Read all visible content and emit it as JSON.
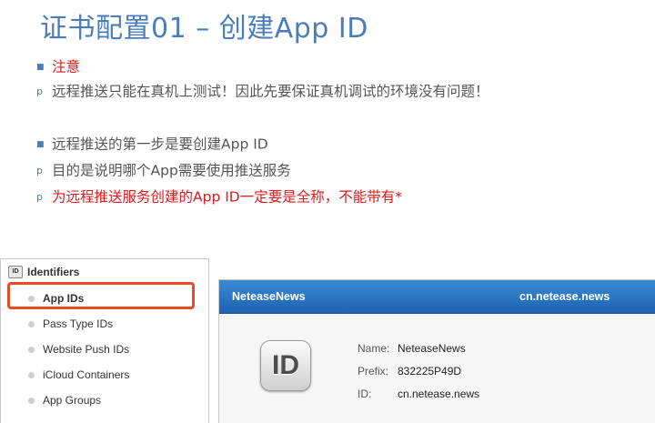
{
  "slide": {
    "title": "证书配置01 – 创建App ID",
    "bullets": [
      {
        "marker": "square",
        "text": "注意",
        "color": "red"
      },
      {
        "marker": "p",
        "text": "远程推送只能在真机上测试！因此先要保证真机调试的环境没有问题！",
        "color": "gray"
      },
      {
        "marker": "square",
        "text": "远程推送的第一步是要创建App ID",
        "color": "gray"
      },
      {
        "marker": "p",
        "text": "目的是说明哪个App需要使用推送服务",
        "color": "gray"
      },
      {
        "marker": "p",
        "text": "为远程推送服务创建的App ID一定要是全称，不能带有*",
        "color": "red"
      }
    ],
    "marker_glyphs": {
      "square": "■",
      "p": "p"
    }
  },
  "identifiers": {
    "badge": "ID",
    "header": "Identifiers",
    "items": [
      {
        "label": "App IDs",
        "active": true
      },
      {
        "label": "Pass Type IDs",
        "active": false
      },
      {
        "label": "Website Push IDs",
        "active": false
      },
      {
        "label": "iCloud Containers",
        "active": false
      },
      {
        "label": "App Groups",
        "active": false
      }
    ]
  },
  "app_card": {
    "name": "NeteaseNews",
    "bundle": "cn.netease.news",
    "icon_text": "ID",
    "fields": [
      {
        "key": "Name:",
        "value": "NeteaseNews"
      },
      {
        "key": "Prefix:",
        "value": "832225P49D"
      },
      {
        "key": "ID:",
        "value": "cn.netease.news"
      }
    ]
  },
  "colors": {
    "title_blue": "#4a7dbb",
    "warning_red": "#e0191b",
    "highlight_orange": "#e84b25",
    "card_header_blue": "#2a78c6"
  }
}
